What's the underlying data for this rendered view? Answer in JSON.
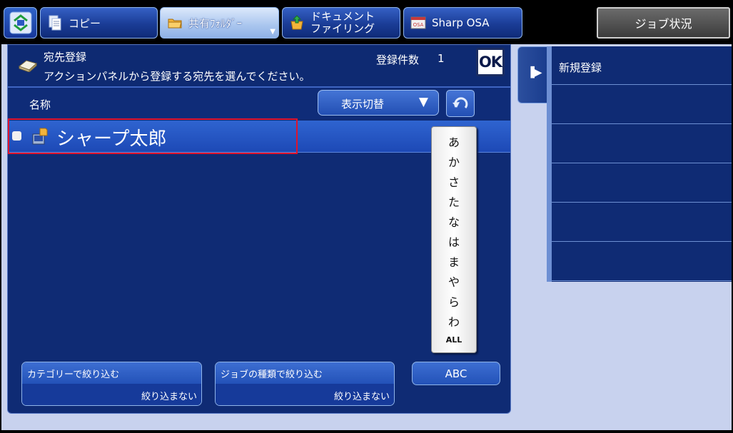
{
  "tabs": {
    "home_icon": "home-icon",
    "copy": "コピー",
    "shared_folder": "共有ﾌｫﾙﾀﾞｰ",
    "doc_filing": "ドキュメント\nファイリング",
    "sharp_osa": "Sharp OSA",
    "osa_badge": "OSA"
  },
  "job_status": "ジョブ状況",
  "header": {
    "title": "宛先登録",
    "instruction": "アクションパネルから登録する宛先を選んでください。",
    "count_label": "登録件数",
    "count_value": "1",
    "ok": "OK"
  },
  "column": {
    "name": "名称",
    "display_switch": "表示切替"
  },
  "list": [
    {
      "name": "シャープ太郎",
      "selected": true
    }
  ],
  "kana_index": [
    "あ",
    "か",
    "さ",
    "た",
    "な",
    "は",
    "ま",
    "や",
    "ら",
    "わ",
    "ALL"
  ],
  "filters": {
    "category": {
      "title": "カテゴリーで絞り込む",
      "value": "絞り込まない"
    },
    "job_type": {
      "title": "ジョブの種類で絞り込む",
      "value": "絞り込まない"
    }
  },
  "abc_button": "ABC",
  "action_panel": {
    "items": [
      "新規登録",
      "",
      "",
      "",
      "",
      ""
    ]
  },
  "colors": {
    "panel_bg": "#0f2b74",
    "row_selected": "#2f64d0",
    "highlight_outline": "#e0142c",
    "screen_bg": "#c8d2ee"
  }
}
